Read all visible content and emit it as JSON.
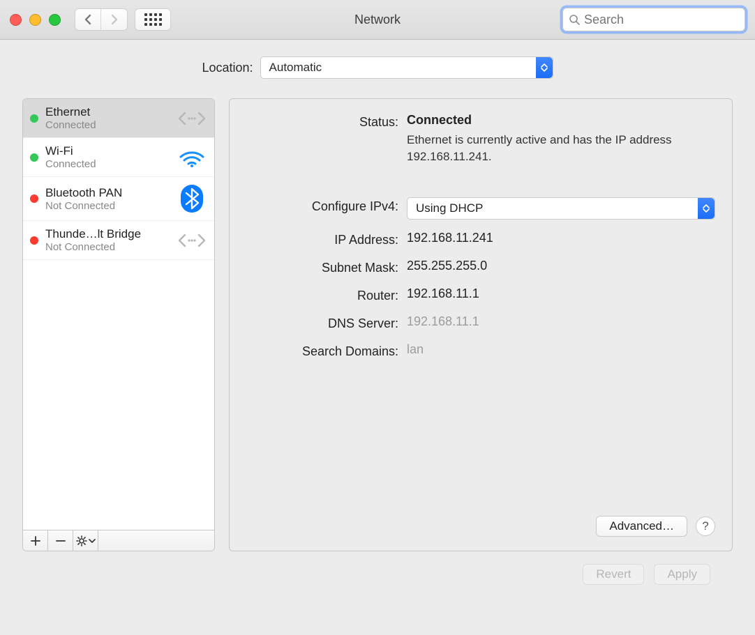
{
  "window": {
    "title": "Network",
    "search_placeholder": "Search"
  },
  "location": {
    "label": "Location:",
    "value": "Automatic"
  },
  "interfaces": [
    {
      "name": "Ethernet",
      "status": "Connected",
      "dot": "green",
      "icon": "ethernet",
      "selected": true
    },
    {
      "name": "Wi-Fi",
      "status": "Connected",
      "dot": "green",
      "icon": "wifi",
      "selected": false
    },
    {
      "name": "Bluetooth PAN",
      "status": "Not Connected",
      "dot": "red",
      "icon": "bluetooth",
      "selected": false
    },
    {
      "name": "Thunde…lt Bridge",
      "status": "Not Connected",
      "dot": "red",
      "icon": "ethernet",
      "selected": false
    }
  ],
  "detail": {
    "status_label": "Status:",
    "status_value": "Connected",
    "status_desc": "Ethernet is currently active and has the IP address 192.168.11.241.",
    "configure_label": "Configure IPv4:",
    "configure_value": "Using DHCP",
    "ip_label": "IP Address:",
    "ip_value": "192.168.11.241",
    "subnet_label": "Subnet Mask:",
    "subnet_value": "255.255.255.0",
    "router_label": "Router:",
    "router_value": "192.168.11.1",
    "dns_label": "DNS Server:",
    "dns_value": "192.168.11.1",
    "search_label": "Search Domains:",
    "search_value": "lan",
    "advanced_btn": "Advanced…"
  },
  "footer": {
    "revert": "Revert",
    "apply": "Apply"
  }
}
